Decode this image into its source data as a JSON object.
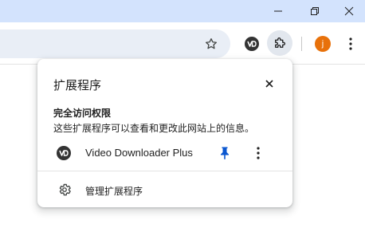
{
  "window": {
    "controls": [
      {
        "name": "minimize-button",
        "icon": "minimize-icon"
      },
      {
        "name": "restore-button",
        "icon": "restore-icon"
      },
      {
        "name": "close-window-button",
        "icon": "close-icon"
      }
    ]
  },
  "toolbar": {
    "bookmark_icon": "star-icon",
    "video_ext_icon": "video-downloader-icon",
    "extensions_icon": "puzzle-icon",
    "profile_initial": "j",
    "menu_icon": "more-vertical-icon"
  },
  "popup": {
    "title": "扩展程序",
    "section_heading": "完全访问权限",
    "section_description": "这些扩展程序可以查看和更改此网站上的信息。",
    "extensions": [
      {
        "name": "Video Downloader Plus",
        "pinned": true
      }
    ],
    "manage_label": "管理扩展程序"
  },
  "colors": {
    "titlebar": "#d3e3fd",
    "omnibox": "#e9eef6",
    "pin_active": "#0b57d0",
    "avatar": "#e8710a"
  }
}
